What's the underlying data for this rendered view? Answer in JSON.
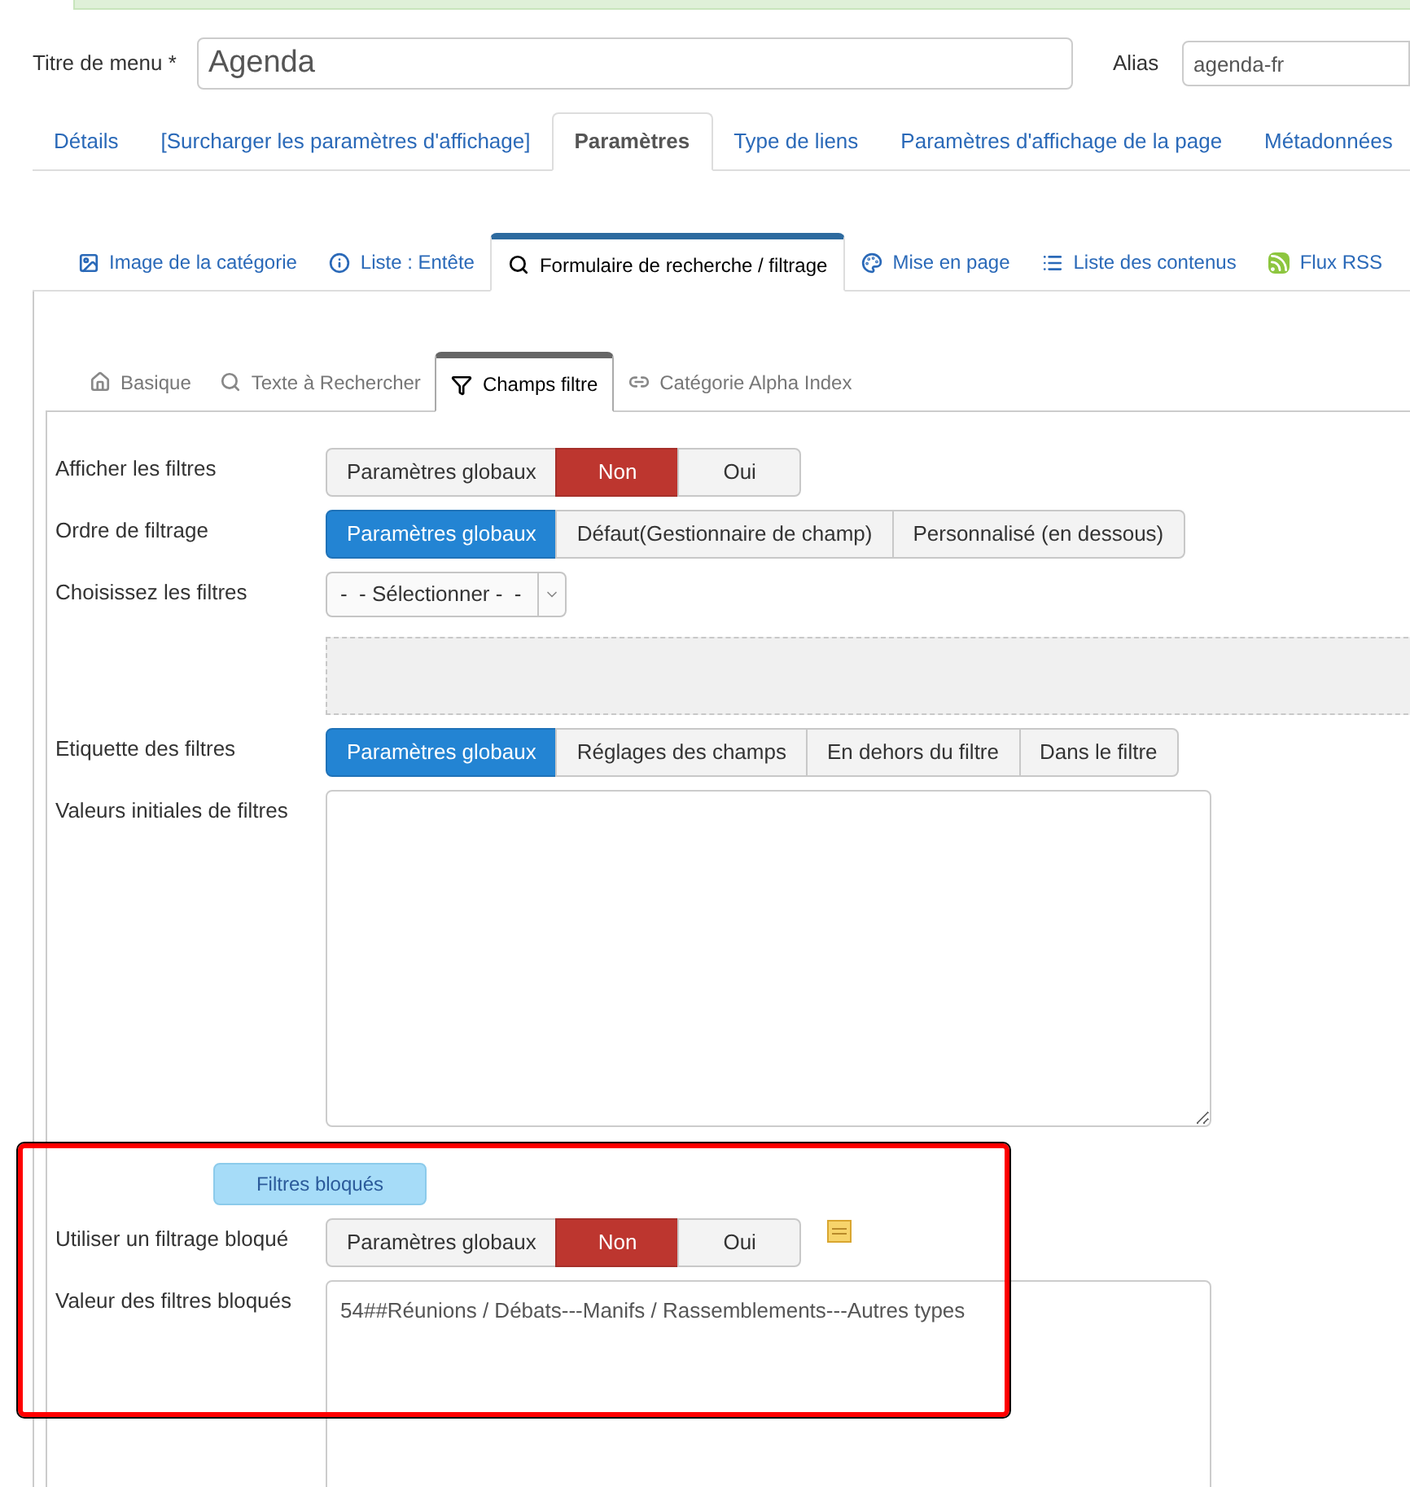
{
  "menu_title": {
    "label": "Titre de menu *",
    "value": "Agenda"
  },
  "alias": {
    "label": "Alias",
    "value": "agenda-fr"
  },
  "tabs": [
    {
      "label": "Détails",
      "selected": false
    },
    {
      "label": "[Surcharger les paramètres d'affichage]",
      "selected": false
    },
    {
      "label": "Paramètres",
      "selected": true
    },
    {
      "label": "Type de liens",
      "selected": false
    },
    {
      "label": "Paramètres d'affichage de la page",
      "selected": false
    },
    {
      "label": "Métadonnées",
      "selected": false
    }
  ],
  "subtabs": [
    {
      "label": "Image de la catégorie",
      "kind": "image",
      "selected": false
    },
    {
      "label": "Liste : Entête",
      "kind": "info",
      "selected": false
    },
    {
      "label": "Formulaire de recherche / filtrage",
      "kind": "search",
      "selected": true
    },
    {
      "label": "Mise en page",
      "kind": "palette",
      "selected": false
    },
    {
      "label": "Liste des contenus",
      "kind": "list",
      "selected": false
    },
    {
      "label": "Flux RSS",
      "kind": "rss",
      "selected": false
    }
  ],
  "inner_tabs": [
    {
      "label": "Basique",
      "kind": "home",
      "selected": false
    },
    {
      "label": "Texte à Rechercher",
      "kind": "search",
      "selected": false
    },
    {
      "label": "Champs filtre",
      "kind": "filter",
      "selected": true
    },
    {
      "label": "Catégorie Alpha Index",
      "kind": "link",
      "selected": false
    }
  ],
  "fields": [
    {
      "kind": "radio",
      "label": "Afficher les filtres",
      "options": [
        {
          "label": "Paramètres globaux",
          "kind": "global",
          "selected": false
        },
        {
          "label": "Non",
          "kind": "no",
          "selected": true
        },
        {
          "label": "Oui",
          "kind": "yes",
          "selected": false
        }
      ]
    },
    {
      "kind": "radio",
      "label": "Ordre de filtrage",
      "options": [
        {
          "label": "Paramètres globaux",
          "kind": "global",
          "selected": true
        },
        {
          "label": "Défaut(Gestionnaire de champ)",
          "kind": "plain",
          "selected": false
        },
        {
          "label": "Personnalisé (en dessous)",
          "kind": "plain",
          "selected": false
        }
      ]
    },
    {
      "kind": "select",
      "label": "Choisissez les filtres",
      "value": "-  - Sélectionner -  -"
    },
    {
      "kind": "radio",
      "label": "Etiquette des filtres",
      "options": [
        {
          "label": "Paramètres globaux",
          "kind": "global",
          "selected": true
        },
        {
          "label": "Réglages des champs",
          "kind": "plain",
          "selected": false
        },
        {
          "label": "En dehors du filtre",
          "kind": "plain",
          "selected": false
        },
        {
          "label": "Dans le filtre",
          "kind": "plain",
          "selected": false
        }
      ]
    },
    {
      "kind": "textarea",
      "label": "Valeurs initiales de filtres"
    },
    {
      "kind": "badge",
      "label": "Filtres bloqués"
    },
    {
      "kind": "radio",
      "label": "Utiliser un filtrage bloqué",
      "note_icon": true,
      "options": [
        {
          "label": "Paramètres globaux",
          "kind": "global",
          "selected": false
        },
        {
          "label": "Non",
          "kind": "no",
          "selected": true
        },
        {
          "label": "Oui",
          "kind": "yes",
          "selected": false
        }
      ]
    },
    {
      "kind": "textarea",
      "label": "Valeur des filtres bloqués",
      "value": "54##Réunions / Débats---Manifs / Rassemblements---Autres types"
    }
  ]
}
